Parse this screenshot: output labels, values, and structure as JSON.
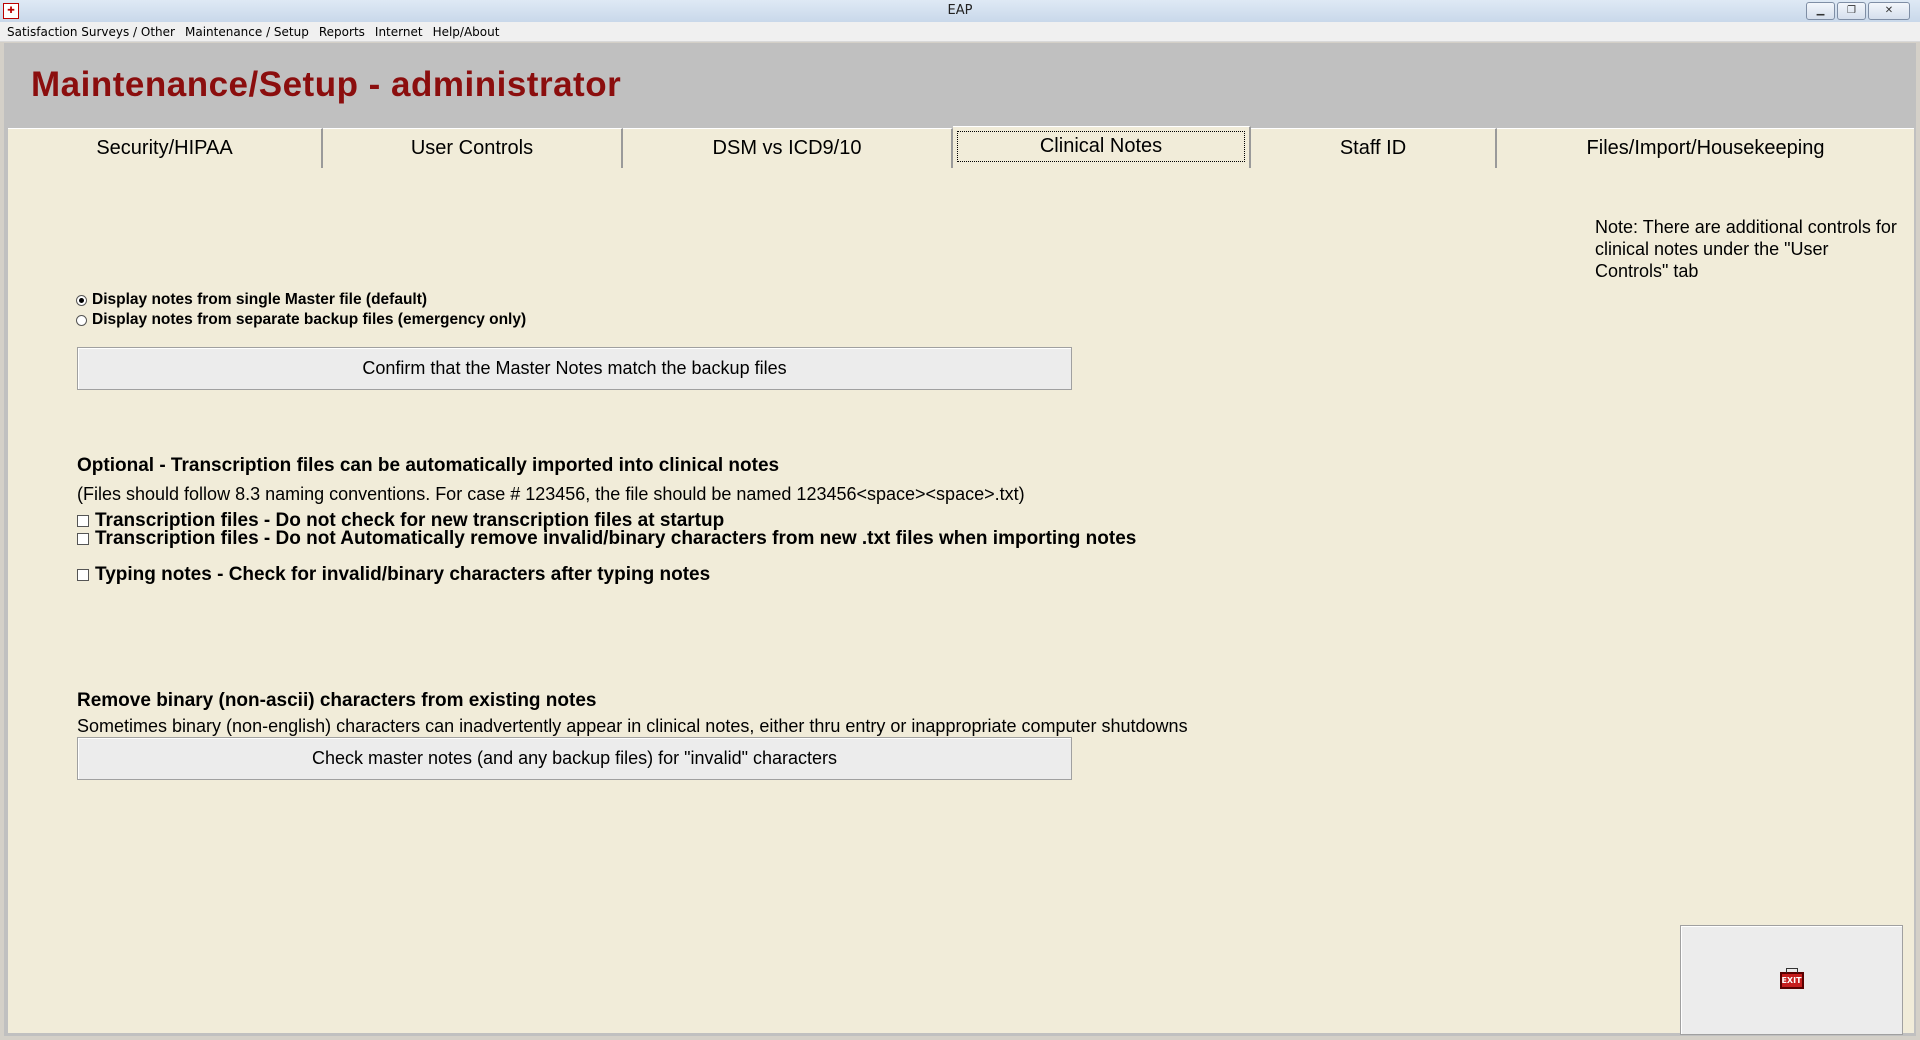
{
  "window": {
    "title": "EAP",
    "app_icon": "app-icon",
    "controls": [
      "minimize-icon",
      "restore-icon",
      "close-icon"
    ]
  },
  "menu": [
    "Satisfaction Surveys / Other",
    "Maintenance / Setup",
    "Reports",
    "Internet",
    "Help/About"
  ],
  "page_title": "Maintenance/Setup - administrator",
  "tabs": [
    {
      "label": "Security/HIPAA",
      "active": false
    },
    {
      "label": "User Controls",
      "active": false
    },
    {
      "label": "DSM vs ICD9/10",
      "active": false
    },
    {
      "label": "Clinical Notes",
      "active": true
    },
    {
      "label": "Staff ID",
      "active": false
    },
    {
      "label": "Files/Import/Housekeeping",
      "active": false
    }
  ],
  "panel": {
    "note": "Note: There are additional controls for clinical notes under the \"User Controls\" tab",
    "display_options": [
      {
        "label": "Display notes from single Master file (default)",
        "selected": true
      },
      {
        "label": "Display notes from separate backup files (emergency only)",
        "selected": false
      }
    ],
    "confirm_button": "Confirm that the Master Notes match the backup files",
    "transcription_heading": "Optional - Transcription files can be automatically imported into clinical notes",
    "transcription_info": "(Files should follow 8.3 naming conventions.  For case # 123456, the file should be named 123456<space><space>.txt)",
    "checkboxes": [
      {
        "label": "Transcription files - Do not check for new transcription files at startup",
        "checked": false
      },
      {
        "label": "Transcription files - Do not Automatically remove invalid/binary characters from new .txt files when importing notes",
        "checked": false
      },
      {
        "label": "Typing notes - Check for invalid/binary characters after typing notes",
        "checked": false
      }
    ],
    "binary_heading": "Remove binary (non-ascii) characters from existing notes",
    "binary_info": "Sometimes binary (non-english) characters can inadvertently appear in clinical notes, either thru entry or inappropriate computer shutdowns",
    "check_button": "Check master notes (and any backup files) for \"invalid\" characters",
    "exit_icon_text": "EXIT"
  }
}
